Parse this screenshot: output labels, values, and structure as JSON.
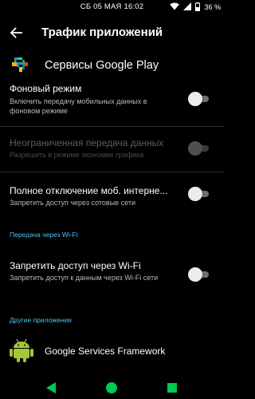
{
  "status_bar": {
    "datetime": "СБ 05 МАЯ 16:02",
    "battery": "36 %",
    "icons": [
      "wifi-icon",
      "signal-icon",
      "battery-icon"
    ]
  },
  "app_bar": {
    "title": "Трафик приложений",
    "back_icon": "arrow-back-icon"
  },
  "app": {
    "name": "Сервисы Google Play",
    "icon": "google-play-services-icon"
  },
  "preferences": [
    {
      "title": "Фоновый режим",
      "summary": "Включить передачу мобильных данных в фоновом режиме",
      "checked": false,
      "enabled": true
    },
    {
      "title": "Неограниченная передача данных",
      "summary": "Разрешить в режиме экономии трафика",
      "checked": false,
      "enabled": false
    },
    {
      "title": "Полное отключение моб. интерне...",
      "summary": "Запретить доступ через сотовые сети",
      "checked": false,
      "enabled": true
    }
  ],
  "wifi_section": {
    "header": "Передача через Wi-Fi",
    "preference": {
      "title": "Запретить доступ через Wi-Fi",
      "summary": "Запретить доступ к данным через Wi-Fi сети",
      "checked": false,
      "enabled": true
    }
  },
  "other_apps": {
    "header": "Другие приложения",
    "items": [
      {
        "name": "Google Services Framework",
        "icon": "android-icon"
      }
    ]
  },
  "nav_bar": {
    "icons": [
      "nav-back-icon",
      "nav-home-icon",
      "nav-recents-icon"
    ]
  },
  "colors": {
    "accent": "#4fc3f7",
    "nav": "#00c853",
    "android": "#a4c639",
    "background": "#000000"
  }
}
